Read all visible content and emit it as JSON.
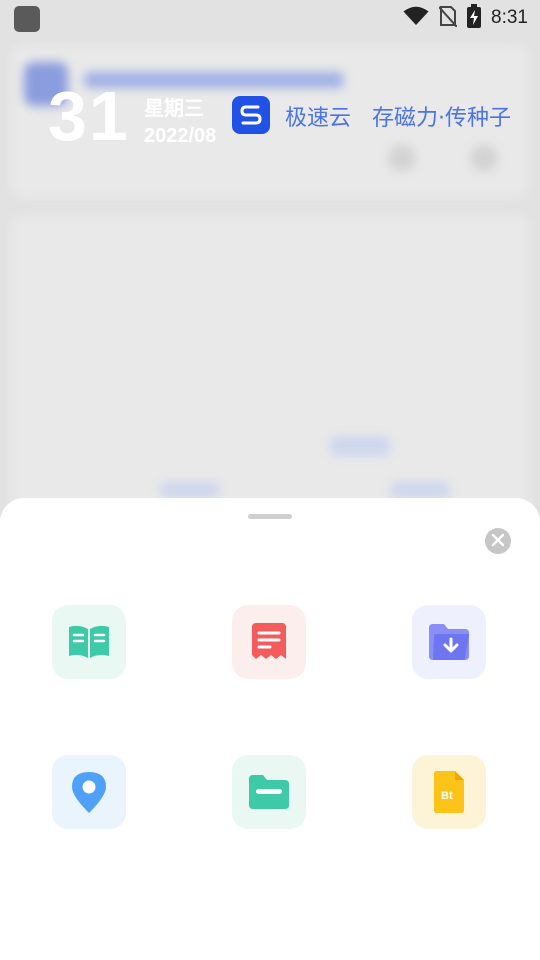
{
  "status_bar": {
    "time": "8:31",
    "icons": [
      "app-icon",
      "wifi-icon",
      "no-sim-icon",
      "battery-charging-icon"
    ]
  },
  "header": {
    "day": "31",
    "weekday": "星期三",
    "year_month": "2022/08",
    "brand_icon": "s-logo-icon",
    "brand_name": "极速云",
    "slogan": "存磁力·传种子"
  },
  "sheet": {
    "close_icon": "close-icon",
    "tiles": [
      {
        "icon": "book-icon",
        "color": "#3ec9a7",
        "bg": "#eaf8f4"
      },
      {
        "icon": "document-icon",
        "color": "#f25c5c",
        "bg": "#fdeeee"
      },
      {
        "icon": "folder-download-icon",
        "color": "#6e75f0",
        "bg": "#eef0fd"
      },
      {
        "icon": "location-pin-icon",
        "color": "#4ea1f7",
        "bg": "#eaf4fd"
      },
      {
        "icon": "folder-icon",
        "color": "#3ec9a7",
        "bg": "#eaf8f4"
      },
      {
        "icon": "bt-file-icon",
        "color": "#fcc419",
        "bg": "#fdf3d6",
        "text": "Bt"
      }
    ]
  },
  "colors": {
    "brand_blue": "#2152e6",
    "link_blue": "#4a74e8"
  }
}
